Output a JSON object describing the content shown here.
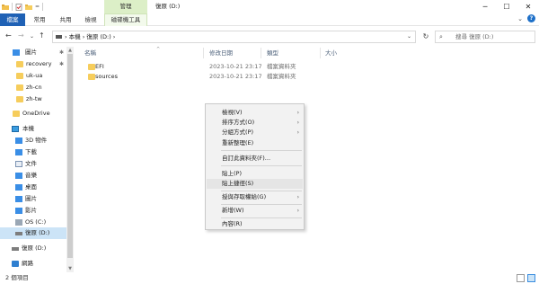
{
  "titlebar": {
    "contextual_group": "管理",
    "window_title": "復原 (D:)",
    "minimize": "─",
    "maximize": "☐",
    "close": "✕",
    "quick_access_arrow": "="
  },
  "ribbon": {
    "tabs": [
      "檔案",
      "常用",
      "共用",
      "檢視"
    ],
    "contextual_tab": "磁碟機工具",
    "expand_glyph": "⌄",
    "help_glyph": "?"
  },
  "nav": {
    "back": "←",
    "forward": "→",
    "dropdown": "⌄",
    "up": "↑",
    "refresh": "↻"
  },
  "address": {
    "path": "›  本機  ›  復原 (D:)  ›",
    "dropdown": "⌄"
  },
  "search": {
    "placeholder": "搜尋 復原 (D:)",
    "icon": "⌕"
  },
  "navpane": {
    "items": [
      {
        "label": "圖片",
        "icon": "picture-icon",
        "pinned": true
      },
      {
        "label": "recovery",
        "icon": "folder-icon",
        "pinned": true
      },
      {
        "label": "uk-ua",
        "icon": "folder-icon",
        "pinned": false
      },
      {
        "label": "zh-cn",
        "icon": "folder-icon",
        "pinned": false
      },
      {
        "label": "zh-tw",
        "icon": "folder-icon",
        "pinned": false
      },
      {
        "label": "OneDrive",
        "icon": "onedrive-folder-icon",
        "pinned": false
      },
      {
        "label": "本機",
        "icon": "pc-icon",
        "pinned": false
      },
      {
        "label": "3D 物件",
        "icon": "3d-objects-icon",
        "pinned": false
      },
      {
        "label": "下載",
        "icon": "download-icon",
        "pinned": false
      },
      {
        "label": "文件",
        "icon": "document-icon",
        "pinned": false
      },
      {
        "label": "音樂",
        "icon": "music-icon",
        "pinned": false
      },
      {
        "label": "桌面",
        "icon": "desktop-icon",
        "pinned": false
      },
      {
        "label": "圖片",
        "icon": "picture-icon",
        "pinned": false
      },
      {
        "label": "影片",
        "icon": "video-icon",
        "pinned": false
      },
      {
        "label": "OS (C:)",
        "icon": "os-drive-icon",
        "pinned": false
      },
      {
        "label": "復原 (D:)",
        "icon": "drive-icon",
        "pinned": false
      },
      {
        "label": "復原 (D:)",
        "icon": "drive-icon",
        "pinned": false
      },
      {
        "label": "網路",
        "icon": "network-icon",
        "pinned": false
      }
    ],
    "pin_glyph": "✱"
  },
  "columns": {
    "name": "名稱",
    "modified": "修改日期",
    "type": "類型",
    "size": "大小"
  },
  "files": [
    {
      "name": "EFI",
      "modified": "2023-10-21 23:17",
      "type": "檔案資料夾",
      "size": ""
    },
    {
      "name": "sources",
      "modified": "2023-10-21 23:17",
      "type": "檔案資料夾",
      "size": ""
    }
  ],
  "context_menu": {
    "items": [
      {
        "label": "檢視(V)",
        "submenu": true
      },
      {
        "label": "排序方式(O)",
        "submenu": true
      },
      {
        "label": "分組方式(P)",
        "submenu": true
      },
      {
        "label": "重新整理(E)",
        "submenu": false
      },
      {
        "label": "自訂此資料夾(F)...",
        "submenu": false
      },
      {
        "label": "貼上(P)",
        "submenu": false
      },
      {
        "label": "貼上捷徑(S)",
        "submenu": false
      },
      {
        "label": "授與存取權給(G)",
        "submenu": true
      },
      {
        "label": "新增(W)",
        "submenu": true
      },
      {
        "label": "內容(R)",
        "submenu": false
      }
    ],
    "arrow_glyph": "›"
  },
  "status": {
    "item_count": "2 個項目"
  },
  "colors": {
    "file_tab": "#1f61b5",
    "contextual_group": "#dcefc7",
    "selection": "#cce4f7",
    "folder": "#f6cd5c"
  }
}
